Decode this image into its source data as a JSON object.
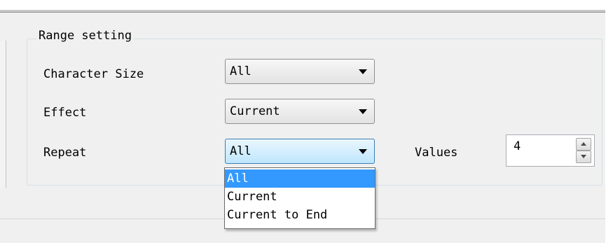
{
  "group": {
    "title": "Range setting"
  },
  "rows": [
    {
      "label": "Character Size",
      "value": "All"
    },
    {
      "label": "Effect",
      "value": "Current"
    },
    {
      "label": "Repeat",
      "value": "All"
    }
  ],
  "values": {
    "label": "Values",
    "value": "4"
  },
  "dropdown": {
    "items": [
      "All",
      "Current",
      "Current to End"
    ],
    "selected_index": 0
  },
  "colors": {
    "selection": "#3399ff",
    "active_combo_border": "#3c7fb1",
    "dialog_background": "#f0f0f0"
  }
}
